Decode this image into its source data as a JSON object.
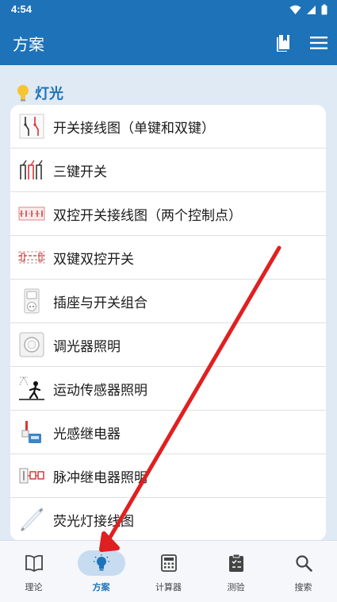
{
  "status": {
    "time": "4:54"
  },
  "appbar": {
    "title": "方案"
  },
  "section": {
    "title": "灯光"
  },
  "items": [
    {
      "label": "开关接线图（单键和双键）",
      "icon": "single-double-switch-icon"
    },
    {
      "label": "三键开关",
      "icon": "three-gang-switch-icon"
    },
    {
      "label": "双控开关接线图（两个控制点）",
      "icon": "two-way-switch-wiring-icon"
    },
    {
      "label": "双键双控开关",
      "icon": "double-two-way-switch-icon"
    },
    {
      "label": "插座与开关组合",
      "icon": "socket-switch-combo-icon"
    },
    {
      "label": "调光器照明",
      "icon": "dimmer-icon"
    },
    {
      "label": "运动传感器照明",
      "icon": "motion-sensor-icon"
    },
    {
      "label": "光感继电器",
      "icon": "light-sensor-relay-icon"
    },
    {
      "label": "脉冲继电器照明",
      "icon": "impulse-relay-icon"
    },
    {
      "label": "荧光灯接线图",
      "icon": "fluorescent-lamp-icon"
    }
  ],
  "nav": [
    {
      "label": "理论",
      "icon": "book-icon",
      "active": false
    },
    {
      "label": "方案",
      "icon": "lightbulb-icon",
      "active": true
    },
    {
      "label": "计算器",
      "icon": "calculator-icon",
      "active": false
    },
    {
      "label": "测验",
      "icon": "clipboard-check-icon",
      "active": false
    },
    {
      "label": "搜索",
      "icon": "search-icon",
      "active": false
    }
  ],
  "colors": {
    "primary": "#1e72b8",
    "background": "#dfeaf5",
    "annotation_arrow": "#e02020"
  }
}
